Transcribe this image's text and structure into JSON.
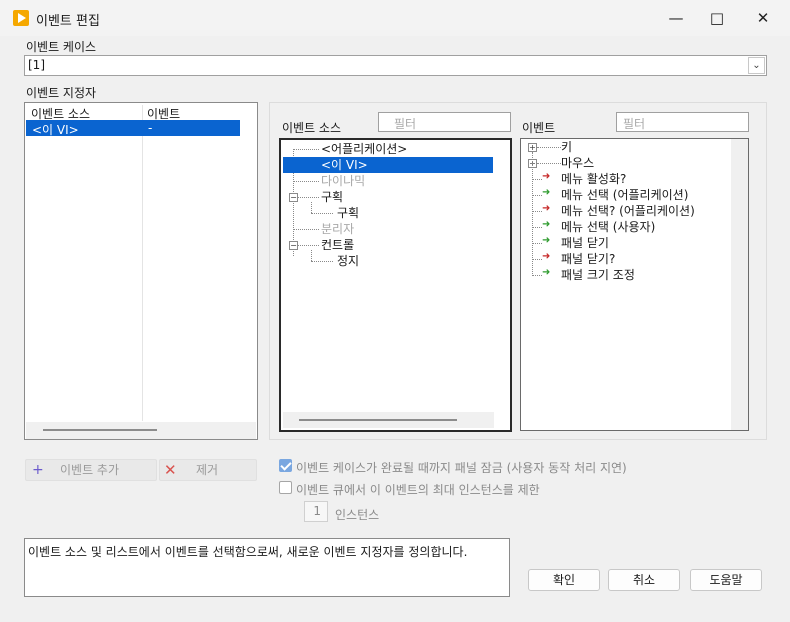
{
  "window": {
    "title": "이벤트 편집"
  },
  "event_case": {
    "label": "이벤트 케이스",
    "value": "[1]"
  },
  "specifiers": {
    "label": "이벤트 지정자",
    "columns": [
      "이벤트 소스",
      "이벤트"
    ],
    "rows": [
      {
        "source": "<이 VI>",
        "event": "-"
      }
    ]
  },
  "source_panel": {
    "label": "이벤트 소스",
    "filter_placeholder": "필터",
    "items": {
      "application": "<어플리케이션>",
      "this_vi": "<이 VI>",
      "dynamic": "다이나믹",
      "pane_group": "구획",
      "pane": "구획",
      "splitter": "분리자",
      "controls": "컨트롤",
      "stop": "정지"
    }
  },
  "event_panel": {
    "label": "이벤트",
    "filter_placeholder": "필터",
    "items": {
      "key": "키",
      "mouse": "마우스",
      "menu_activation": "메뉴 활성화?",
      "menu_select_app": "메뉴 선택 (어플리케이션)",
      "menu_select_app_q": "메뉴 선택? (어플리케이션)",
      "menu_select_user": "메뉴 선택 (사용자)",
      "panel_close": "패널 닫기",
      "panel_close_q": "패널 닫기?",
      "panel_resize": "패널 크기 조정"
    }
  },
  "buttons": {
    "add_event": "이벤트 추가",
    "remove": "제거",
    "ok": "확인",
    "cancel": "취소",
    "help": "도움말"
  },
  "options": {
    "lock_panel": {
      "label": "이벤트 케이스가 완료될 때까지 패널 잠금 (사용자 동작 처리 지연)",
      "checked": true
    },
    "limit_queue": {
      "label": "이벤트 큐에서 이 이벤트의 최대 인스턴스를 제한",
      "checked": false
    },
    "instances": {
      "value": "1",
      "label": "인스턴스"
    }
  },
  "description": "이벤트 소스 및 리스트에서 이벤트를 선택함으로써, 새로운 이벤트 지정자를 정의합니다.",
  "colors": {
    "selection": "#0a64d0",
    "arrow_green": "#2e9b2e",
    "arrow_red": "#c62828"
  }
}
